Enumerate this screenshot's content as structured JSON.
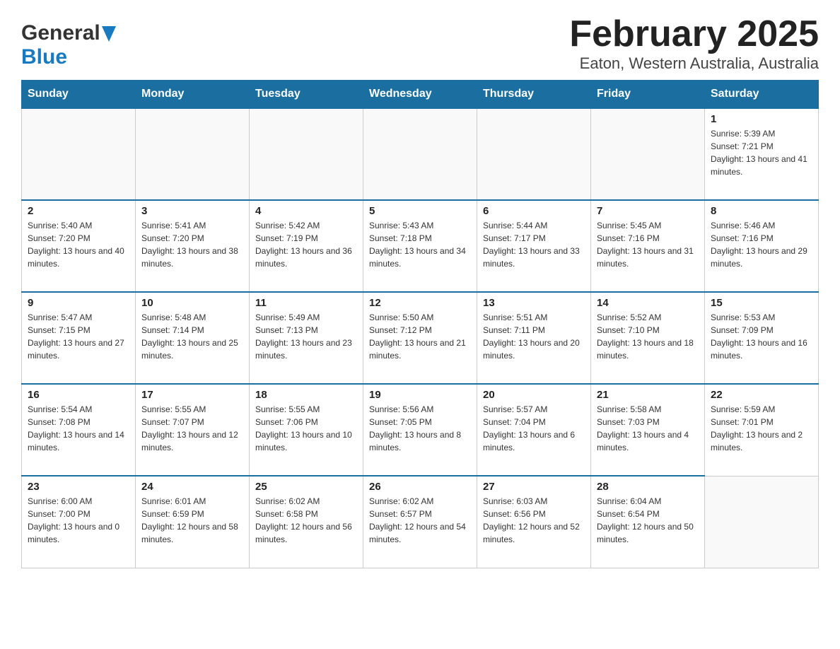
{
  "header": {
    "logo_general": "General",
    "logo_blue": "Blue",
    "title": "February 2025",
    "subtitle": "Eaton, Western Australia, Australia"
  },
  "days_of_week": [
    "Sunday",
    "Monday",
    "Tuesday",
    "Wednesday",
    "Thursday",
    "Friday",
    "Saturday"
  ],
  "weeks": [
    [
      {
        "day": "",
        "info": ""
      },
      {
        "day": "",
        "info": ""
      },
      {
        "day": "",
        "info": ""
      },
      {
        "day": "",
        "info": ""
      },
      {
        "day": "",
        "info": ""
      },
      {
        "day": "",
        "info": ""
      },
      {
        "day": "1",
        "info": "Sunrise: 5:39 AM\nSunset: 7:21 PM\nDaylight: 13 hours and 41 minutes."
      }
    ],
    [
      {
        "day": "2",
        "info": "Sunrise: 5:40 AM\nSunset: 7:20 PM\nDaylight: 13 hours and 40 minutes."
      },
      {
        "day": "3",
        "info": "Sunrise: 5:41 AM\nSunset: 7:20 PM\nDaylight: 13 hours and 38 minutes."
      },
      {
        "day": "4",
        "info": "Sunrise: 5:42 AM\nSunset: 7:19 PM\nDaylight: 13 hours and 36 minutes."
      },
      {
        "day": "5",
        "info": "Sunrise: 5:43 AM\nSunset: 7:18 PM\nDaylight: 13 hours and 34 minutes."
      },
      {
        "day": "6",
        "info": "Sunrise: 5:44 AM\nSunset: 7:17 PM\nDaylight: 13 hours and 33 minutes."
      },
      {
        "day": "7",
        "info": "Sunrise: 5:45 AM\nSunset: 7:16 PM\nDaylight: 13 hours and 31 minutes."
      },
      {
        "day": "8",
        "info": "Sunrise: 5:46 AM\nSunset: 7:16 PM\nDaylight: 13 hours and 29 minutes."
      }
    ],
    [
      {
        "day": "9",
        "info": "Sunrise: 5:47 AM\nSunset: 7:15 PM\nDaylight: 13 hours and 27 minutes."
      },
      {
        "day": "10",
        "info": "Sunrise: 5:48 AM\nSunset: 7:14 PM\nDaylight: 13 hours and 25 minutes."
      },
      {
        "day": "11",
        "info": "Sunrise: 5:49 AM\nSunset: 7:13 PM\nDaylight: 13 hours and 23 minutes."
      },
      {
        "day": "12",
        "info": "Sunrise: 5:50 AM\nSunset: 7:12 PM\nDaylight: 13 hours and 21 minutes."
      },
      {
        "day": "13",
        "info": "Sunrise: 5:51 AM\nSunset: 7:11 PM\nDaylight: 13 hours and 20 minutes."
      },
      {
        "day": "14",
        "info": "Sunrise: 5:52 AM\nSunset: 7:10 PM\nDaylight: 13 hours and 18 minutes."
      },
      {
        "day": "15",
        "info": "Sunrise: 5:53 AM\nSunset: 7:09 PM\nDaylight: 13 hours and 16 minutes."
      }
    ],
    [
      {
        "day": "16",
        "info": "Sunrise: 5:54 AM\nSunset: 7:08 PM\nDaylight: 13 hours and 14 minutes."
      },
      {
        "day": "17",
        "info": "Sunrise: 5:55 AM\nSunset: 7:07 PM\nDaylight: 13 hours and 12 minutes."
      },
      {
        "day": "18",
        "info": "Sunrise: 5:55 AM\nSunset: 7:06 PM\nDaylight: 13 hours and 10 minutes."
      },
      {
        "day": "19",
        "info": "Sunrise: 5:56 AM\nSunset: 7:05 PM\nDaylight: 13 hours and 8 minutes."
      },
      {
        "day": "20",
        "info": "Sunrise: 5:57 AM\nSunset: 7:04 PM\nDaylight: 13 hours and 6 minutes."
      },
      {
        "day": "21",
        "info": "Sunrise: 5:58 AM\nSunset: 7:03 PM\nDaylight: 13 hours and 4 minutes."
      },
      {
        "day": "22",
        "info": "Sunrise: 5:59 AM\nSunset: 7:01 PM\nDaylight: 13 hours and 2 minutes."
      }
    ],
    [
      {
        "day": "23",
        "info": "Sunrise: 6:00 AM\nSunset: 7:00 PM\nDaylight: 13 hours and 0 minutes."
      },
      {
        "day": "24",
        "info": "Sunrise: 6:01 AM\nSunset: 6:59 PM\nDaylight: 12 hours and 58 minutes."
      },
      {
        "day": "25",
        "info": "Sunrise: 6:02 AM\nSunset: 6:58 PM\nDaylight: 12 hours and 56 minutes."
      },
      {
        "day": "26",
        "info": "Sunrise: 6:02 AM\nSunset: 6:57 PM\nDaylight: 12 hours and 54 minutes."
      },
      {
        "day": "27",
        "info": "Sunrise: 6:03 AM\nSunset: 6:56 PM\nDaylight: 12 hours and 52 minutes."
      },
      {
        "day": "28",
        "info": "Sunrise: 6:04 AM\nSunset: 6:54 PM\nDaylight: 12 hours and 50 minutes."
      },
      {
        "day": "",
        "info": ""
      }
    ]
  ]
}
